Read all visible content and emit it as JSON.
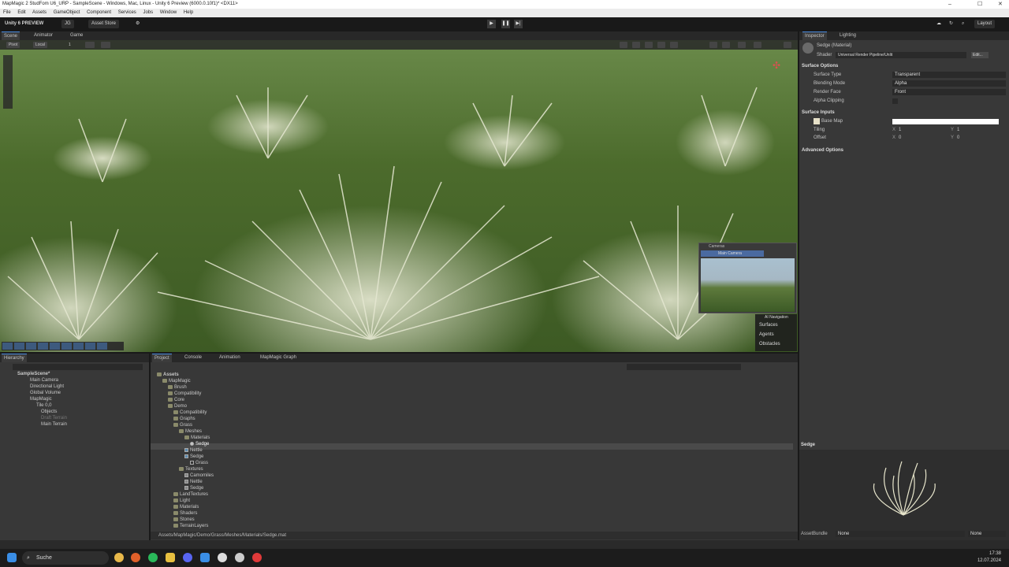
{
  "window": {
    "title": "MapMagic 2 StudFom U6_URP - SampleScene - Windows, Mac, Linux - Unity 6 Preview (6000.0.10f1)* <DX11>"
  },
  "menu": [
    "File",
    "Edit",
    "Assets",
    "GameObject",
    "Component",
    "Services",
    "Jobs",
    "Window",
    "Help"
  ],
  "toolbar": {
    "unity_label": "Unity 6 PREVIEW",
    "account": "JG",
    "asset_store": "Asset Store",
    "layout": "Layout"
  },
  "scene_tabs": {
    "scene": "Scene",
    "animator": "Animator",
    "game": "Game"
  },
  "scene_toolbar": {
    "pivot": "Pivot",
    "local": "Local",
    "value": "1"
  },
  "camera_preview": {
    "title": "Cameras",
    "camera": "Main Camera"
  },
  "ai_navigation": {
    "title": "AI Navigation",
    "items": [
      "Surfaces",
      "Agents",
      "Obstacles"
    ]
  },
  "inspector": {
    "tabs": {
      "inspector": "Inspector",
      "lighting": "Lighting"
    },
    "material_name": "Sedge (Material)",
    "shader_label": "Shader",
    "shader_value": "Universal Render Pipeline/Unlit",
    "edit_button": "Edit...",
    "surface_options": "Surface Options",
    "surface_type_label": "Surface Type",
    "surface_type": "Transparent",
    "blending_label": "Blending Mode",
    "blending": "Alpha",
    "render_face_label": "Render Face",
    "render_face": "Front",
    "alpha_clipping_label": "Alpha Clipping",
    "surface_inputs": "Surface Inputs",
    "base_map": "Base Map",
    "tiling_label": "Tiling",
    "tiling_x": "1",
    "tiling_y": "1",
    "offset_label": "Offset",
    "offset_x": "0",
    "offset_y": "0",
    "advanced_options": "Advanced Options"
  },
  "hierarchy": {
    "tab": "Hierarchy",
    "items": [
      "SampleScene*",
      "Main Camera",
      "Directional Light",
      "Global Volume",
      "MapMagic",
      "Tile 0,0",
      "Objects",
      "Draft Terrain",
      "Main Terrain"
    ]
  },
  "project": {
    "tabs": {
      "project": "Project",
      "console": "Console",
      "animation": "Animation",
      "graph": "MapMagic Graph"
    },
    "tree": [
      "Assets",
      "MapMagic",
      "Brush",
      "Compatibility",
      "Core",
      "Demo",
      "Compatibility",
      "Graphs",
      "Grass",
      "Meshes",
      "Materials",
      "Sedge",
      "Nettle",
      "Sedge",
      "Grass",
      "Textures",
      "Camomiles",
      "Nettle",
      "Sedge",
      "LandTextures",
      "Light",
      "Materials",
      "Shaders",
      "Stones",
      "TerrainLayers"
    ],
    "path": "Assets/MapMagic/Demo/Grass/Meshes/Materials/Sedge.mat"
  },
  "preview": {
    "title": "Sedge",
    "asset_bundle_label": "AssetBundle",
    "asset_bundle": "None",
    "variant": "None"
  },
  "taskbar": {
    "search": "Suche",
    "time": "17:38",
    "date": "12.07.2024"
  }
}
